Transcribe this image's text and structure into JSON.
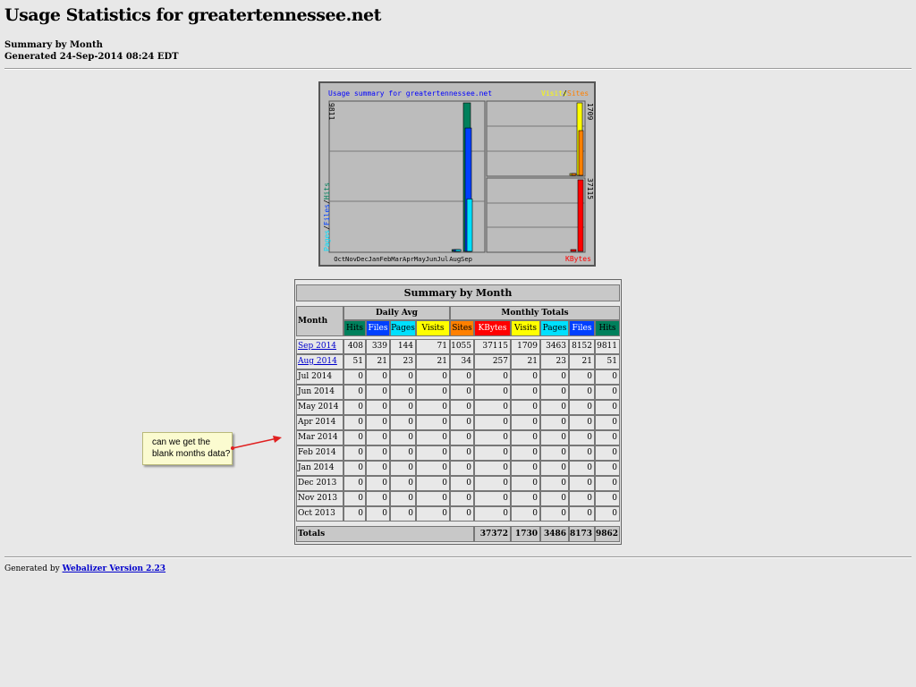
{
  "page": {
    "title": "Usage Statistics for greatertennessee.net",
    "subtitle": "Summary by Month",
    "generated": "Generated 24-Sep-2014 08:24 EDT"
  },
  "graph": {
    "title": "Usage summary for greatertennessee.net",
    "left_axis_max": "9811",
    "left_legend": [
      "Pages",
      "/",
      "Files",
      "/",
      "Hits"
    ],
    "right_top_legend": [
      "Visits",
      "/",
      "Sites"
    ],
    "right_top_max": "1709",
    "right_bottom_max": "37115",
    "right_bottom_legend": "KBytes",
    "months": [
      "Oct",
      "Nov",
      "Dec",
      "Jan",
      "Feb",
      "Mar",
      "Apr",
      "May",
      "Jun",
      "Jul",
      "Aug",
      "Sep"
    ],
    "colors": {
      "hits": "#00805c",
      "files": "#0040ff",
      "pages": "#00e0ff",
      "visits": "#ffff00",
      "sites": "#ff8000",
      "kbytes": "#ff0000",
      "title_text": "#0000ff"
    }
  },
  "table": {
    "title": "Summary by Month",
    "month_header": "Month",
    "daily_avg_header": "Daily Avg",
    "monthly_totals_header": "Monthly Totals",
    "daily_cols": [
      {
        "label": "Hits",
        "bg": "#00805c"
      },
      {
        "label": "Files",
        "bg": "#0040ff"
      },
      {
        "label": "Pages",
        "bg": "#00e0ff"
      },
      {
        "label": "Visits",
        "bg": "#ffff00"
      }
    ],
    "monthly_cols": [
      {
        "label": "Sites",
        "bg": "#ff8000"
      },
      {
        "label": "KBytes",
        "bg": "#ff0000"
      },
      {
        "label": "Visits",
        "bg": "#ffff00"
      },
      {
        "label": "Pages",
        "bg": "#00e0ff"
      },
      {
        "label": "Files",
        "bg": "#0040ff"
      },
      {
        "label": "Hits",
        "bg": "#00805c"
      }
    ],
    "rows": [
      {
        "month": "Sep 2014",
        "link": true,
        "values": [
          "408",
          "339",
          "144",
          "71",
          "1055",
          "37115",
          "1709",
          "3463",
          "8152",
          "9811"
        ]
      },
      {
        "month": "Aug 2014",
        "link": true,
        "values": [
          "51",
          "21",
          "23",
          "21",
          "34",
          "257",
          "21",
          "23",
          "21",
          "51"
        ]
      },
      {
        "month": "Jul 2014",
        "link": false,
        "values": [
          "0",
          "0",
          "0",
          "0",
          "0",
          "0",
          "0",
          "0",
          "0",
          "0"
        ]
      },
      {
        "month": "Jun 2014",
        "link": false,
        "values": [
          "0",
          "0",
          "0",
          "0",
          "0",
          "0",
          "0",
          "0",
          "0",
          "0"
        ]
      },
      {
        "month": "May 2014",
        "link": false,
        "values": [
          "0",
          "0",
          "0",
          "0",
          "0",
          "0",
          "0",
          "0",
          "0",
          "0"
        ]
      },
      {
        "month": "Apr 2014",
        "link": false,
        "values": [
          "0",
          "0",
          "0",
          "0",
          "0",
          "0",
          "0",
          "0",
          "0",
          "0"
        ]
      },
      {
        "month": "Mar 2014",
        "link": false,
        "values": [
          "0",
          "0",
          "0",
          "0",
          "0",
          "0",
          "0",
          "0",
          "0",
          "0"
        ]
      },
      {
        "month": "Feb 2014",
        "link": false,
        "values": [
          "0",
          "0",
          "0",
          "0",
          "0",
          "0",
          "0",
          "0",
          "0",
          "0"
        ]
      },
      {
        "month": "Jan 2014",
        "link": false,
        "values": [
          "0",
          "0",
          "0",
          "0",
          "0",
          "0",
          "0",
          "0",
          "0",
          "0"
        ]
      },
      {
        "month": "Dec 2013",
        "link": false,
        "values": [
          "0",
          "0",
          "0",
          "0",
          "0",
          "0",
          "0",
          "0",
          "0",
          "0"
        ]
      },
      {
        "month": "Nov 2013",
        "link": false,
        "values": [
          "0",
          "0",
          "0",
          "0",
          "0",
          "0",
          "0",
          "0",
          "0",
          "0"
        ]
      },
      {
        "month": "Oct 2013",
        "link": false,
        "values": [
          "0",
          "0",
          "0",
          "0",
          "0",
          "0",
          "0",
          "0",
          "0",
          "0"
        ]
      }
    ],
    "totals_label": "Totals",
    "totals": [
      "37372",
      "1730",
      "3486",
      "8173",
      "9862"
    ]
  },
  "callout": {
    "text": "can we get the\nblank months data?",
    "arrow_color": "#e02020"
  },
  "footer": {
    "prefix": "Generated by ",
    "link": "Webalizer Version 2.23"
  },
  "chart_data": {
    "type": "bar",
    "categories": [
      "Oct",
      "Nov",
      "Dec",
      "Jan",
      "Feb",
      "Mar",
      "Apr",
      "May",
      "Jun",
      "Jul",
      "Aug",
      "Sep"
    ],
    "title": "Usage summary for greatertennessee.net",
    "panels": [
      {
        "name": "Pages/Files/Hits",
        "ylim": [
          0,
          9811
        ],
        "series": [
          {
            "name": "Hits",
            "values": [
              0,
              0,
              0,
              0,
              0,
              0,
              0,
              0,
              0,
              0,
              51,
              9811
            ]
          },
          {
            "name": "Files",
            "values": [
              0,
              0,
              0,
              0,
              0,
              0,
              0,
              0,
              0,
              0,
              21,
              8152
            ]
          },
          {
            "name": "Pages",
            "values": [
              0,
              0,
              0,
              0,
              0,
              0,
              0,
              0,
              0,
              0,
              23,
              3463
            ]
          }
        ]
      },
      {
        "name": "Visits/Sites",
        "ylim": [
          0,
          1709
        ],
        "series": [
          {
            "name": "Visits",
            "values": [
              0,
              0,
              0,
              0,
              0,
              0,
              0,
              0,
              0,
              0,
              21,
              1709
            ]
          },
          {
            "name": "Sites",
            "values": [
              0,
              0,
              0,
              0,
              0,
              0,
              0,
              0,
              0,
              0,
              34,
              1055
            ]
          }
        ]
      },
      {
        "name": "KBytes",
        "ylim": [
          0,
          37115
        ],
        "series": [
          {
            "name": "KBytes",
            "values": [
              0,
              0,
              0,
              0,
              0,
              0,
              0,
              0,
              0,
              0,
              257,
              37115
            ]
          }
        ]
      }
    ],
    "grid": true
  }
}
